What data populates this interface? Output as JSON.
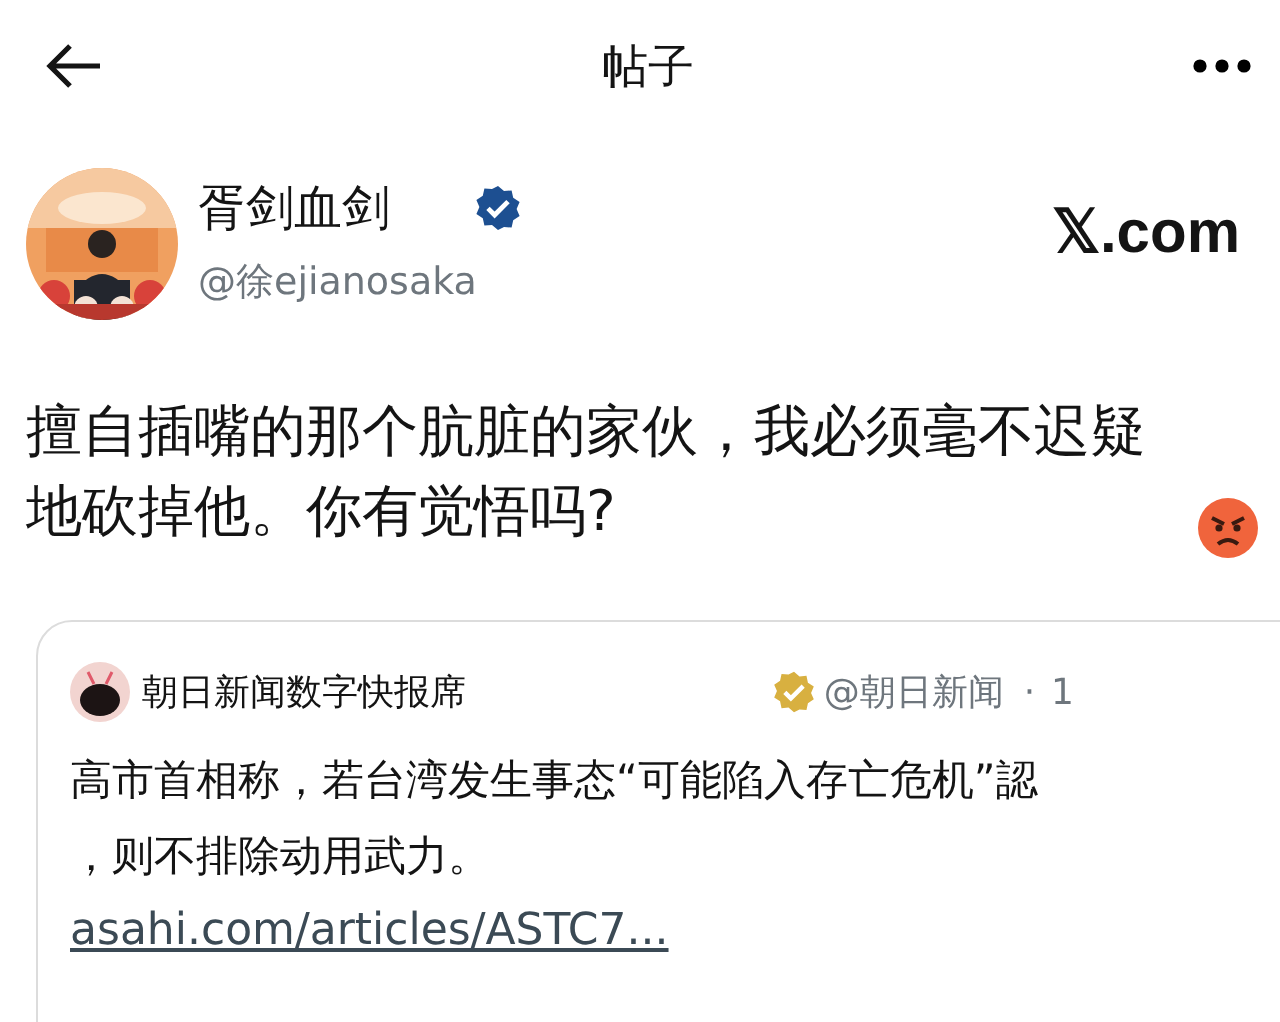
{
  "header": {
    "title": "帖子"
  },
  "post": {
    "author": {
      "name": "胥剑血剑",
      "handle": "@徐ejianosaka",
      "verified": true
    },
    "brand": "𝕏.com",
    "text": "擅自插嘴的那个肮脏的家伙，我必须毫不迟疑地砍掉他。你有觉悟吗?",
    "quote": {
      "author": {
        "name": "朝日新闻数字快报席",
        "handle": "@朝日新闻",
        "verified": true
      },
      "separator": "·",
      "time": "1",
      "text": "高市首相称，若台湾发生事态“可能陷入存亡危机”認，则不排除动用武力。",
      "link": "asahi.com/articles/ASTC7..."
    }
  }
}
